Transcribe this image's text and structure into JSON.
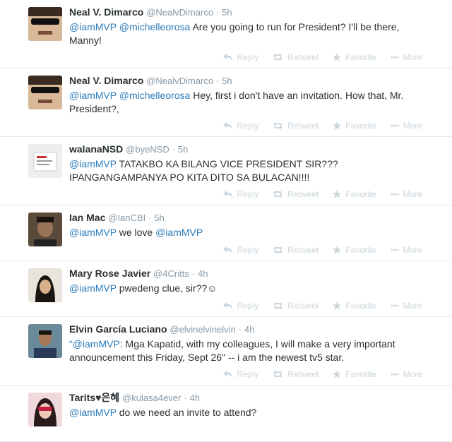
{
  "actions": {
    "reply": "Reply",
    "retweet": "Retweet",
    "favorite": "Favorite",
    "more": "More"
  },
  "tweets": [
    {
      "name": "Neal V. Dimarco",
      "handle": "@NealvDimarco",
      "time": "5h",
      "segments": [
        [
          "@iamMVP",
          1
        ],
        [
          " ",
          0
        ],
        [
          "@michelleorosa",
          1
        ],
        [
          " Are you going to run for President? I'll be there, Manny!",
          0
        ]
      ]
    },
    {
      "name": "Neal V. Dimarco",
      "handle": "@NealvDimarco",
      "time": "5h",
      "segments": [
        [
          "@iamMVP",
          1
        ],
        [
          " ",
          0
        ],
        [
          "@michelleorosa",
          1
        ],
        [
          " Hey, first i don't have an invitation. How that, Mr. President?,",
          0
        ]
      ]
    },
    {
      "name": "walanaNSD",
      "handle": "@byeNSD",
      "time": "5h",
      "segments": [
        [
          "@iamMVP",
          1
        ],
        [
          " TATAKBO KA BILANG VICE PRESIDENT SIR??? IPANGANGAMPANYA PO KITA DITO SA BULACAN!!!!",
          0
        ]
      ]
    },
    {
      "name": "Ian Mac",
      "handle": "@IanCBI",
      "time": "5h",
      "segments": [
        [
          "@iamMVP",
          1
        ],
        [
          " we love ",
          0
        ],
        [
          "@iamMVP",
          1
        ]
      ]
    },
    {
      "name": "Mary Rose Javier",
      "handle": "@4Critts",
      "time": "4h",
      "segments": [
        [
          "@iamMVP",
          1
        ],
        [
          " pwedeng clue, sir??☺",
          0
        ]
      ]
    },
    {
      "name": "Elvin García Luciano",
      "handle": "@elvinelvinelvin",
      "time": "4h",
      "segments": [
        [
          "“",
          0
        ],
        [
          "@iamMVP",
          1
        ],
        [
          ": Mga Kapatid, with my colleagues, I will make a very important announcement this Friday, Sept 26\" -- i am the newest tv5 star.",
          0
        ]
      ]
    },
    {
      "name": "Tarits♥은혜",
      "handle": "@kulasa4ever",
      "time": "4h",
      "segments": [
        [
          "@iamMVP",
          1
        ],
        [
          " do we need an invite to attend?",
          0
        ]
      ]
    }
  ],
  "colors": {
    "mention": "#2b7bb9",
    "muted": "#8899a6",
    "action": "#ccd6dd",
    "divider": "#e1e8ed"
  }
}
